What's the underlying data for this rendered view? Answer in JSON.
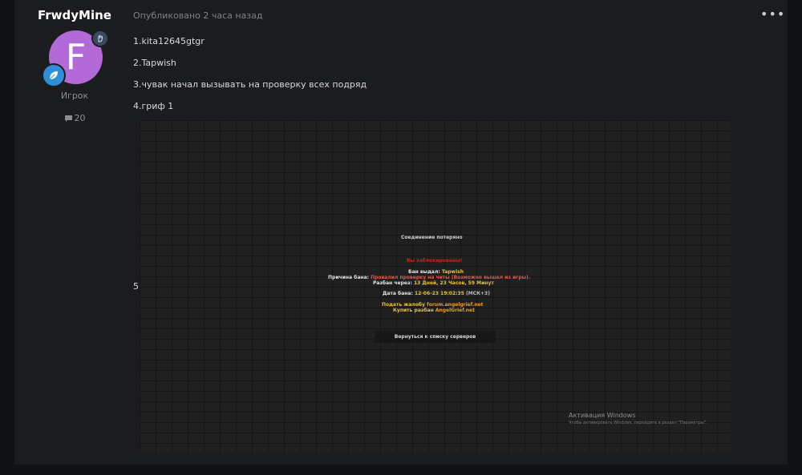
{
  "author": {
    "name": "FrwdyMine",
    "avatar_letter": "F",
    "avatar_color": "#b469d8",
    "role": "Игрок",
    "post_count": "20",
    "badges": [
      "hand-icon",
      "leaf-icon"
    ]
  },
  "post": {
    "published": "Опубликовано 2 часа назад",
    "more_icon": "•••",
    "lines": [
      "1.kita12645gtgr",
      "2.Tapwish",
      "3.чувак начал вызывать на проверку всех подряд",
      "4.гриф 1",
      "5."
    ]
  },
  "screenshot": {
    "title": "Соединение потеряно",
    "banned_msg": "Вы заблокированы!",
    "banned_by_label": "Бан выдал:",
    "banned_by_value": "Tapwish",
    "reason_label": "Причина бана:",
    "reason_value": "Провалил проверку на читы (Возможно вышел из игры).",
    "unban_in_label": "Разбан через:",
    "unban_in_value": "13 Дней, 23 Часов, 59 Минут",
    "date_label": "Дата бана:",
    "date_value": "12-06-23 19:02:35",
    "date_tz": "(МСК+3)",
    "complaint_label": "Подать жалобу",
    "complaint_value": "forum.angelgrief.net",
    "buy_label": "Купить разбан",
    "buy_value": "AngelGrief.net",
    "back_button": "Вернуться к списку серверов",
    "win_title": "Активация Windows",
    "win_sub": "Чтобы активировать Windows, перейдите в раздел \"Параметры\"."
  }
}
